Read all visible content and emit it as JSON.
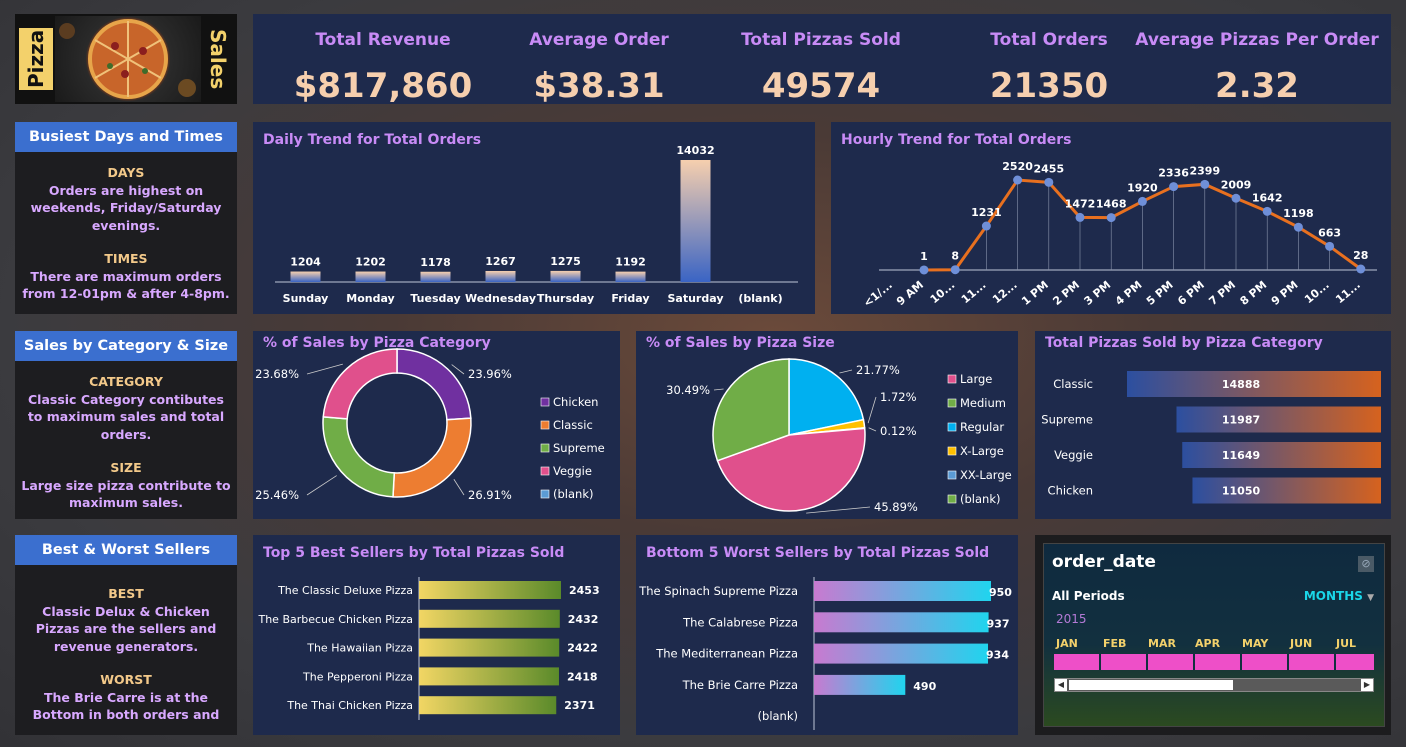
{
  "logo": {
    "left_text": "Pizza",
    "right_text": "Sales"
  },
  "kpis": [
    {
      "label": "Total Revenue",
      "value": "$817,860"
    },
    {
      "label": "Average Order",
      "value": "$38.31"
    },
    {
      "label": "Total Pizzas Sold",
      "value": "49574"
    },
    {
      "label": "Total Orders",
      "value": "21350"
    },
    {
      "label": "Average Pizzas Per Order",
      "value": "2.32"
    }
  ],
  "side": {
    "busiest": {
      "title": "Busiest Days and Times",
      "days_head": "DAYS",
      "days_text": "Orders are highest on weekends, Friday/Saturday evenings.",
      "times_head": "TIMES",
      "times_text": "There are maximum orders from 12-01pm & after 4-8pm."
    },
    "category": {
      "title": "Sales by Category & Size",
      "cat_head": "CATEGORY",
      "cat_text": "Classic Category contibutes to maximum sales and total orders.",
      "size_head": "SIZE",
      "size_text": "Large size pizza contribute to maximum sales."
    },
    "sellers": {
      "title": "Best & Worst Sellers",
      "best_head": "BEST",
      "best_text": "Classic Delux & Chicken Pizzas are the sellers and revenue generators.",
      "worst_head": "WORST",
      "worst_text": "The Brie Carre is at the Bottom in both orders and"
    }
  },
  "slicer": {
    "title": "order_date",
    "periods": "All Periods",
    "mode": "MONTHS",
    "year": "2015",
    "months": [
      "JAN",
      "FEB",
      "MAR",
      "APR",
      "MAY",
      "JUN",
      "JUL"
    ]
  },
  "colors": {
    "panel": "#1e2a4c",
    "title": "#c88bf6",
    "kpi_value": "#f6cfae",
    "line": "#e8701f",
    "marker": "#6f8fd8"
  },
  "chart_data": [
    {
      "id": "daily",
      "type": "bar",
      "title": "Daily Trend for Total Orders",
      "categories": [
        "Sunday",
        "Monday",
        "Tuesday",
        "Wednesday",
        "Thursday",
        "Friday",
        "Saturday",
        "(blank)"
      ],
      "values": [
        1204,
        1202,
        1178,
        1267,
        1275,
        1192,
        14032,
        null
      ],
      "value_labels": [
        "1204",
        "1202",
        "1178",
        "1267",
        "1275",
        "1192",
        "14032",
        ""
      ]
    },
    {
      "id": "hourly",
      "type": "line",
      "title": "Hourly Trend for Total Orders",
      "categories": [
        "<1/...",
        "9 AM",
        "10...",
        "11...",
        "12...",
        "1 PM",
        "2 PM",
        "3 PM",
        "4 PM",
        "5 PM",
        "6 PM",
        "7 PM",
        "8 PM",
        "9 PM",
        "10...",
        "11..."
      ],
      "values": [
        1,
        8,
        1231,
        2520,
        2455,
        1472,
        1468,
        1920,
        2336,
        2399,
        2009,
        1642,
        1198,
        663,
        28
      ],
      "value_labels": [
        "1",
        "8",
        "1231",
        "2520",
        "2455",
        "1472",
        "1468",
        "1920",
        "2336",
        "2399",
        "2009",
        "1642",
        "1198",
        "663",
        "28"
      ]
    },
    {
      "id": "category_pct",
      "type": "pie",
      "title": "% of Sales by Pizza Category",
      "categories": [
        "Chicken",
        "Classic",
        "Supreme",
        "Veggie",
        "(blank)"
      ],
      "values": [
        23.96,
        26.91,
        25.46,
        23.68,
        0
      ],
      "value_labels": [
        "23.96%",
        "26.91%",
        "25.46%",
        "23.68%"
      ],
      "colors": [
        "#7030a0",
        "#ed7d31",
        "#70ad47",
        "#e0508c",
        "#5b9bd5"
      ]
    },
    {
      "id": "size_pct",
      "type": "pie",
      "title": "% of Sales by Pizza Size",
      "categories": [
        "Large",
        "Medium",
        "Regular",
        "X-Large",
        "XX-Large",
        "(blank)"
      ],
      "values": [
        45.89,
        30.49,
        21.77,
        1.72,
        0.12,
        0
      ],
      "value_labels": [
        "45.89%",
        "30.49%",
        "21.77%",
        "1.72%",
        "0.12%"
      ],
      "colors": [
        "#e0508c",
        "#70ad47",
        "#00b0f0",
        "#ffc000",
        "#5b9bd5",
        "#70ad47"
      ]
    },
    {
      "id": "category_sold",
      "type": "bar",
      "orientation": "horizontal",
      "title": "Total Pizzas Sold by Pizza Category",
      "categories": [
        "Classic",
        "Supreme",
        "Veggie",
        "Chicken"
      ],
      "values": [
        14888,
        11987,
        11649,
        11050
      ],
      "value_labels": [
        "14888",
        "11987",
        "11649",
        "11050"
      ]
    },
    {
      "id": "best5",
      "type": "bar",
      "orientation": "horizontal",
      "title": "Top 5 Best Sellers by Total Pizzas Sold",
      "categories": [
        "The Classic Deluxe Pizza",
        "The Barbecue Chicken Pizza",
        "The Hawaiian Pizza",
        "The Pepperoni Pizza",
        "The Thai Chicken Pizza"
      ],
      "values": [
        2453,
        2432,
        2422,
        2418,
        2371
      ],
      "value_labels": [
        "2453",
        "2432",
        "2422",
        "2418",
        "2371"
      ]
    },
    {
      "id": "worst5",
      "type": "bar",
      "orientation": "horizontal",
      "title": "Bottom 5 Worst Sellers by Total Pizzas Sold",
      "categories": [
        "The Spinach Supreme Pizza",
        "The Calabrese Pizza",
        "The Mediterranean Pizza",
        "The Brie Carre Pizza",
        "(blank)"
      ],
      "values": [
        950,
        937,
        934,
        490,
        null
      ],
      "value_labels": [
        "950",
        "937",
        "934",
        "490",
        ""
      ]
    }
  ]
}
